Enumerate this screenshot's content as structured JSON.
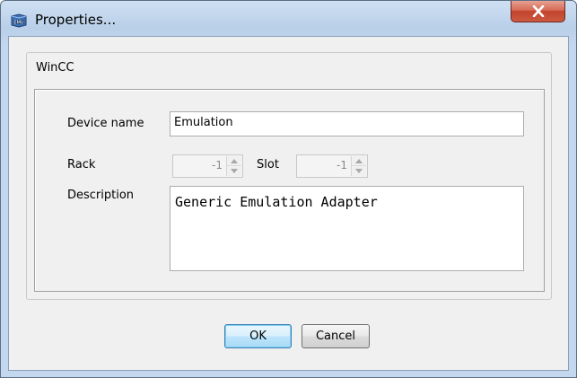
{
  "window": {
    "title": "Properties...",
    "app_icon": "emu-app-icon",
    "close_icon": "close-icon"
  },
  "group": {
    "title": "WinCC"
  },
  "form": {
    "device_name_label": "Device name",
    "device_name_value": "Emulation",
    "rack_label": "Rack",
    "rack_value": "-1",
    "slot_label": "Slot",
    "slot_value": "-1",
    "description_label": "Description",
    "description_value": "Generic Emulation Adapter"
  },
  "buttons": {
    "ok_label": "OK",
    "cancel_label": "Cancel"
  },
  "colors": {
    "title_bar": "#c3d7ee",
    "close_button": "#c2432c",
    "dialog_background": "#f0f0f0",
    "default_button_border": "#3c7fb1"
  }
}
